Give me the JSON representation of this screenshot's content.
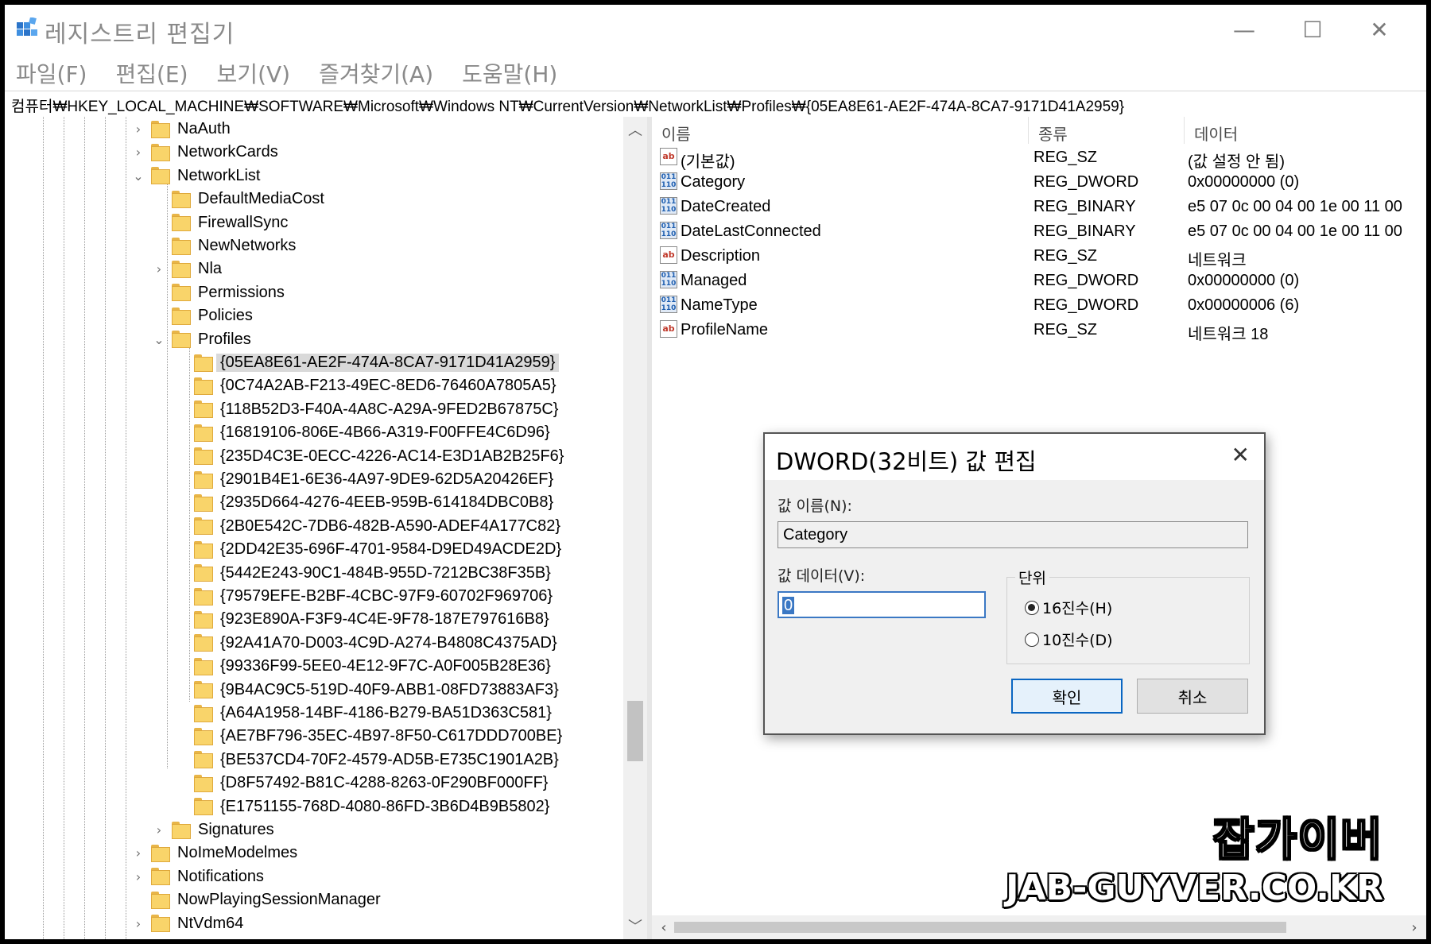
{
  "window": {
    "title": "레지스트리 편집기",
    "minimize": "—",
    "maximize": "☐",
    "close": "✕"
  },
  "menu": [
    "파일(F)",
    "편집(E)",
    "보기(V)",
    "즐겨찾기(A)",
    "도움말(H)"
  ],
  "address": "컴퓨터₩HKEY_LOCAL_MACHINE₩SOFTWARE₩Microsoft₩Windows NT₩CurrentVersion₩NetworkList₩Profiles₩{05EA8E61-AE2F-474A-8CA7-9171D41A2959}",
  "tree": [
    {
      "label": "NaAuth",
      "level": 0,
      "expander": "›"
    },
    {
      "label": "NetworkCards",
      "level": 0,
      "expander": "›"
    },
    {
      "label": "NetworkList",
      "level": 0,
      "expander": "⌄"
    },
    {
      "label": "DefaultMediaCost",
      "level": 1,
      "expander": ""
    },
    {
      "label": "FirewallSync",
      "level": 1,
      "expander": ""
    },
    {
      "label": "NewNetworks",
      "level": 1,
      "expander": ""
    },
    {
      "label": "Nla",
      "level": 1,
      "expander": "›"
    },
    {
      "label": "Permissions",
      "level": 1,
      "expander": ""
    },
    {
      "label": "Policies",
      "level": 1,
      "expander": ""
    },
    {
      "label": "Profiles",
      "level": 1,
      "expander": "⌄"
    },
    {
      "label": "{05EA8E61-AE2F-474A-8CA7-9171D41A2959}",
      "level": 2,
      "expander": "",
      "selected": true
    },
    {
      "label": "{0C74A2AB-F213-49EC-8ED6-76460A7805A5}",
      "level": 2,
      "expander": ""
    },
    {
      "label": "{118B52D3-F40A-4A8C-A29A-9FED2B67875C}",
      "level": 2,
      "expander": ""
    },
    {
      "label": "{16819106-806E-4B66-A319-F00FFE4C6D96}",
      "level": 2,
      "expander": ""
    },
    {
      "label": "{235D4C3E-0ECC-4226-AC14-E3D1AB2B25F6}",
      "level": 2,
      "expander": ""
    },
    {
      "label": "{2901B4E1-6E36-4A97-9DE9-62D5A20426EF}",
      "level": 2,
      "expander": ""
    },
    {
      "label": "{2935D664-4276-4EEB-959B-614184DBC0B8}",
      "level": 2,
      "expander": ""
    },
    {
      "label": "{2B0E542C-7DB6-482B-A590-ADEF4A177C82}",
      "level": 2,
      "expander": ""
    },
    {
      "label": "{2DD42E35-696F-4701-9584-D9ED49ACDE2D}",
      "level": 2,
      "expander": ""
    },
    {
      "label": "{5442E243-90C1-484B-955D-7212BC38F35B}",
      "level": 2,
      "expander": ""
    },
    {
      "label": "{79579EFE-B2BF-4CBC-97F9-60702F969706}",
      "level": 2,
      "expander": ""
    },
    {
      "label": "{923E890A-F3F9-4C4E-9F78-187E797616B8}",
      "level": 2,
      "expander": ""
    },
    {
      "label": "{92A41A70-D003-4C9D-A274-B4808C4375AD}",
      "level": 2,
      "expander": ""
    },
    {
      "label": "{99336F99-5EE0-4E12-9F7C-A0F005B28E36}",
      "level": 2,
      "expander": ""
    },
    {
      "label": "{9B4AC9C5-519D-40F9-ABB1-08FD73883AF3}",
      "level": 2,
      "expander": ""
    },
    {
      "label": "{A64A1958-14BF-4186-B279-BA51D363C581}",
      "level": 2,
      "expander": ""
    },
    {
      "label": "{AE7BF796-35EC-4B97-8F50-C617DDD700BE}",
      "level": 2,
      "expander": ""
    },
    {
      "label": "{BE537CD4-70F2-4579-AD5B-E735C1901A2B}",
      "level": 2,
      "expander": ""
    },
    {
      "label": "{D8F57492-B81C-4288-8263-0F290BF000FF}",
      "level": 2,
      "expander": ""
    },
    {
      "label": "{E1751155-768D-4080-86FD-3B6D4B9B5802}",
      "level": 2,
      "expander": ""
    },
    {
      "label": "Signatures",
      "level": 1,
      "expander": "›"
    },
    {
      "label": "NoImeModelmes",
      "level": 0,
      "expander": "›"
    },
    {
      "label": "Notifications",
      "level": 0,
      "expander": "›"
    },
    {
      "label": "NowPlayingSessionManager",
      "level": 0,
      "expander": ""
    },
    {
      "label": "NtVdm64",
      "level": 0,
      "expander": "›"
    }
  ],
  "list": {
    "headers": [
      "이름",
      "종류",
      "데이터"
    ],
    "rows": [
      {
        "icon": "ab",
        "kind": "string-value-icon",
        "name": "(기본값)",
        "type": "REG_SZ",
        "data": "(값 설정 안 됨)"
      },
      {
        "icon": "011 110",
        "kind": "binary-value-icon",
        "name": "Category",
        "type": "REG_DWORD",
        "data": "0x00000000 (0)"
      },
      {
        "icon": "011 110",
        "kind": "binary-value-icon",
        "name": "DateCreated",
        "type": "REG_BINARY",
        "data": "e5 07 0c 00 04 00 1e 00 11 00"
      },
      {
        "icon": "011 110",
        "kind": "binary-value-icon",
        "name": "DateLastConnected",
        "type": "REG_BINARY",
        "data": "e5 07 0c 00 04 00 1e 00 11 00"
      },
      {
        "icon": "ab",
        "kind": "string-value-icon",
        "name": "Description",
        "type": "REG_SZ",
        "data": "네트워크"
      },
      {
        "icon": "011 110",
        "kind": "binary-value-icon",
        "name": "Managed",
        "type": "REG_DWORD",
        "data": "0x00000000 (0)"
      },
      {
        "icon": "011 110",
        "kind": "binary-value-icon",
        "name": "NameType",
        "type": "REG_DWORD",
        "data": "0x00000006 (6)"
      },
      {
        "icon": "ab",
        "kind": "string-value-icon",
        "name": "ProfileName",
        "type": "REG_SZ",
        "data": "네트워크 18"
      }
    ]
  },
  "dialog": {
    "title": "DWORD(32비트) 값 편집",
    "close": "✕",
    "value_name_label": "값 이름(N):",
    "value_name": "Category",
    "value_data_label": "값 데이터(V):",
    "value_data": "0",
    "base_label": "단위",
    "radio_hex": "16진수(H)",
    "radio_dec": "10진수(D)",
    "base_selected": "hex",
    "ok": "확인",
    "cancel": "취소"
  },
  "watermark": {
    "name": "잡가이버",
    "url": "JAB-GUYVER.CO.KR"
  }
}
